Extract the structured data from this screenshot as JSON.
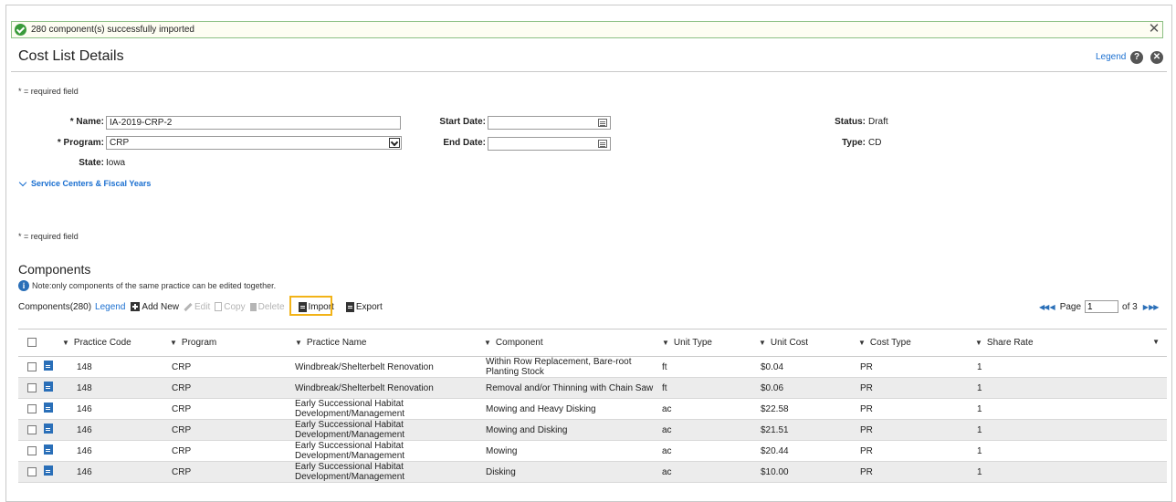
{
  "banner": {
    "message": "280 component(s) successfully imported",
    "close_glyph": "✕"
  },
  "header": {
    "title": "Cost List Details",
    "legend_link": "Legend",
    "help_glyph": "?",
    "close_glyph": "✕"
  },
  "required_note": "* = required field",
  "form": {
    "name_label": "* Name:",
    "name_value": "IA-2019-CRP-2",
    "program_label": "* Program:",
    "program_value": "CRP",
    "state_label": "State:",
    "state_value": "Iowa",
    "start_date_label": "Start Date:",
    "start_date_value": "",
    "end_date_label": "End Date:",
    "end_date_value": "",
    "status_label": "Status:",
    "status_value": "Draft",
    "type_label": "Type:",
    "type_value": "CD"
  },
  "service_centers_link": "Service Centers & Fiscal Years",
  "components": {
    "title": "Components",
    "info_glyph": "i",
    "note": "Note:only components of the same practice can be edited together.",
    "count_label": "Components(280)",
    "legend_link": "Legend",
    "toolbar": {
      "add_new": "Add New",
      "edit": "Edit",
      "copy": "Copy",
      "delete": "Delete",
      "import": "Import",
      "export": "Export"
    },
    "pager": {
      "first_prev": "◀◀ ◀",
      "page_label": "Page",
      "page_value": "1",
      "of_label": "of 3",
      "next_last": "▶ ▶▶"
    },
    "columns": [
      "Practice Code",
      "Program",
      "Practice Name",
      "Component",
      "Unit Type",
      "Unit Cost",
      "Cost Type",
      "Share Rate"
    ],
    "filter_glyph": "▼",
    "rows": [
      {
        "practice_code": "148",
        "program": "CRP",
        "practice_name": "Windbreak/Shelterbelt Renovation",
        "component": "Within Row Replacement, Bare-root Planting Stock",
        "unit_type": "ft",
        "unit_cost": "$0.04",
        "cost_type": "PR",
        "share_rate": "1"
      },
      {
        "practice_code": "148",
        "program": "CRP",
        "practice_name": "Windbreak/Shelterbelt Renovation",
        "component": "Removal and/or Thinning with Chain Saw",
        "unit_type": "ft",
        "unit_cost": "$0.06",
        "cost_type": "PR",
        "share_rate": "1"
      },
      {
        "practice_code": "146",
        "program": "CRP",
        "practice_name": "Early Successional Habitat Development/Management",
        "component": "Mowing and Heavy Disking",
        "unit_type": "ac",
        "unit_cost": "$22.58",
        "cost_type": "PR",
        "share_rate": "1"
      },
      {
        "practice_code": "146",
        "program": "CRP",
        "practice_name": "Early Successional Habitat Development/Management",
        "component": "Mowing and Disking",
        "unit_type": "ac",
        "unit_cost": "$21.51",
        "cost_type": "PR",
        "share_rate": "1"
      },
      {
        "practice_code": "146",
        "program": "CRP",
        "practice_name": "Early Successional Habitat Development/Management",
        "component": "Mowing",
        "unit_type": "ac",
        "unit_cost": "$20.44",
        "cost_type": "PR",
        "share_rate": "1"
      },
      {
        "practice_code": "146",
        "program": "CRP",
        "practice_name": "Early Successional Habitat Development/Management",
        "component": "Disking",
        "unit_type": "ac",
        "unit_cost": "$10.00",
        "cost_type": "PR",
        "share_rate": "1"
      }
    ]
  }
}
